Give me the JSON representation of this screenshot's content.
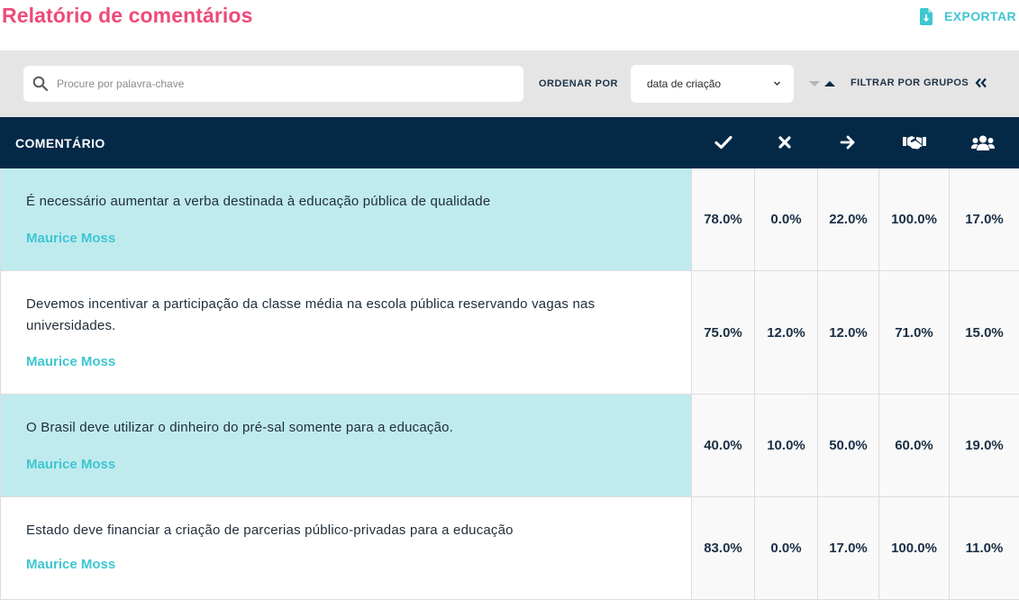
{
  "header": {
    "title": "Relatório de comentários",
    "export_label": "EXPORTAR"
  },
  "toolbar": {
    "search_placeholder": "Procure por palavra-chave",
    "sort_label": "ORDENAR POR",
    "sort_value": "data de criação",
    "filter_groups_label": "FILTRAR POR GRUPOS"
  },
  "table": {
    "comment_header": "COMENTÁRIO",
    "column_icons": [
      "check-icon",
      "cross-icon",
      "arrow-right-icon",
      "handshake-icon",
      "group-icon"
    ],
    "rows": [
      {
        "text": "É necessário aumentar a verba destinada à educação pública de qualidade",
        "author": "Maurice Moss",
        "highlight": true,
        "values": [
          "78.0%",
          "0.0%",
          "22.0%",
          "100.0%",
          "17.0%"
        ]
      },
      {
        "text": "Devemos incentivar a participação da classe média na escola pública reservando vagas nas universidades.",
        "author": "Maurice Moss",
        "highlight": false,
        "values": [
          "75.0%",
          "12.0%",
          "12.0%",
          "71.0%",
          "15.0%"
        ]
      },
      {
        "text": "O Brasil deve utilizar o dinheiro do pré-sal somente para a educação.",
        "author": "Maurice Moss",
        "highlight": true,
        "values": [
          "40.0%",
          "10.0%",
          "50.0%",
          "60.0%",
          "19.0%"
        ]
      },
      {
        "text": "Estado deve financiar a criação de parcerias público-privadas para a educação",
        "author": "Maurice Moss",
        "highlight": false,
        "values": [
          "83.0%",
          "0.0%",
          "17.0%",
          "100.0%",
          "11.0%"
        ]
      }
    ]
  },
  "colors": {
    "title": "#ee4a7a",
    "accent": "#3ec6d2",
    "header_bg": "#032947",
    "highlight_row": "#c0ebee"
  }
}
